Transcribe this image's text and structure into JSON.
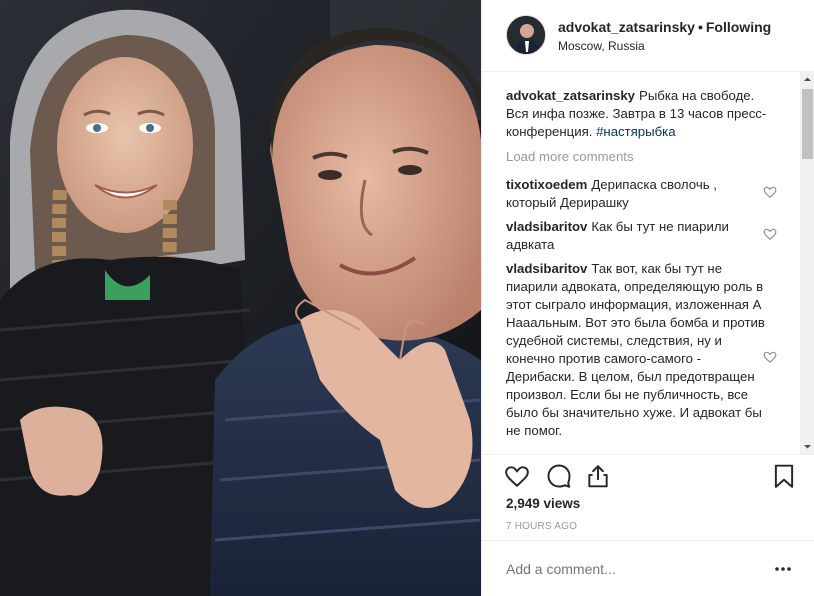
{
  "post": {
    "username": "advokat_zatsarinsky",
    "separator": "•",
    "follow_status": "Following",
    "location": "Moscow, Russia",
    "likes": "2,949 views",
    "time_ago": "7 HOURS AGO"
  },
  "caption": {
    "user": "advokat_zatsarinsky",
    "text": "Рыбка на свободе. Вся инфа позже. Завтра в 13 часов пресс-конференция.",
    "hashtag": "#настярыбка"
  },
  "load_more": "Load more comments",
  "comments": [
    {
      "user": "tixotixoedem",
      "text": "Дерипаска сволочь , который Дерирашку"
    },
    {
      "user": "vladsibaritov",
      "text": "Как бы тут не пиарили адвката"
    },
    {
      "user": "vladsibaritov",
      "text": "Так вот, как бы тут не пиарили адвоката, определяющую роль в этот сыграло информация, изложенная А Нааальным. Вот это была бомба и против судебной системы, следствия, ну и конечно против самого-самого - Дерибаски. В целом, был предотвращен произвол. Если бы не публичность, все было бы значительно хуже. И адвокат бы не помог."
    }
  ],
  "add_comment": {
    "placeholder": "Add a comment..."
  },
  "icons": {
    "like": "heart-icon",
    "comment": "comment-bubble-icon",
    "share": "share-icon",
    "save": "bookmark-icon",
    "more": "more-options-icon"
  },
  "colors": {
    "text": "#262626",
    "muted": "#999999",
    "hashtag": "#003569",
    "border": "#efefef"
  }
}
